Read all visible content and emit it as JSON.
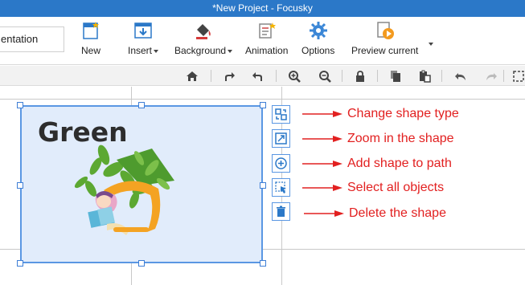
{
  "window": {
    "title": "*New Project - Focusky"
  },
  "ribbon": {
    "document_field": "entation",
    "buttons": [
      {
        "label": "New",
        "icon": "new-doc-icon"
      },
      {
        "label": "Insert",
        "icon": "insert-icon"
      },
      {
        "label": "Background",
        "icon": "paint-bucket-icon"
      },
      {
        "label": "Animation",
        "icon": "animation-icon"
      },
      {
        "label": "Options",
        "icon": "gear-icon"
      },
      {
        "label": "Preview current",
        "icon": "preview-play-icon"
      }
    ]
  },
  "toolbar": {
    "icons": [
      "home-icon",
      "redo-step-icon",
      "undo-step-icon",
      "zoom-in-icon",
      "zoom-out-icon",
      "lock-icon",
      "copy-icon",
      "paste-icon",
      "undo-icon",
      "redo-icon",
      "more-icon"
    ]
  },
  "canvas": {
    "shape": {
      "title": "Green",
      "fill": "#e1ecfb",
      "border": "#5a97e3"
    },
    "side_buttons": [
      "change-shape-type-icon",
      "zoom-in-shape-icon",
      "add-to-path-icon",
      "select-all-objects-icon",
      "delete-icon"
    ],
    "annotations": [
      "Change shape type",
      "Zoom in the shape",
      "Add shape to path",
      "Select all objects",
      "Delete the shape"
    ],
    "annotation_color": "#e22020"
  },
  "colors": {
    "titlebar": "#2b78c8",
    "accent": "#2b78c8",
    "selection": "#3f7fd6"
  }
}
